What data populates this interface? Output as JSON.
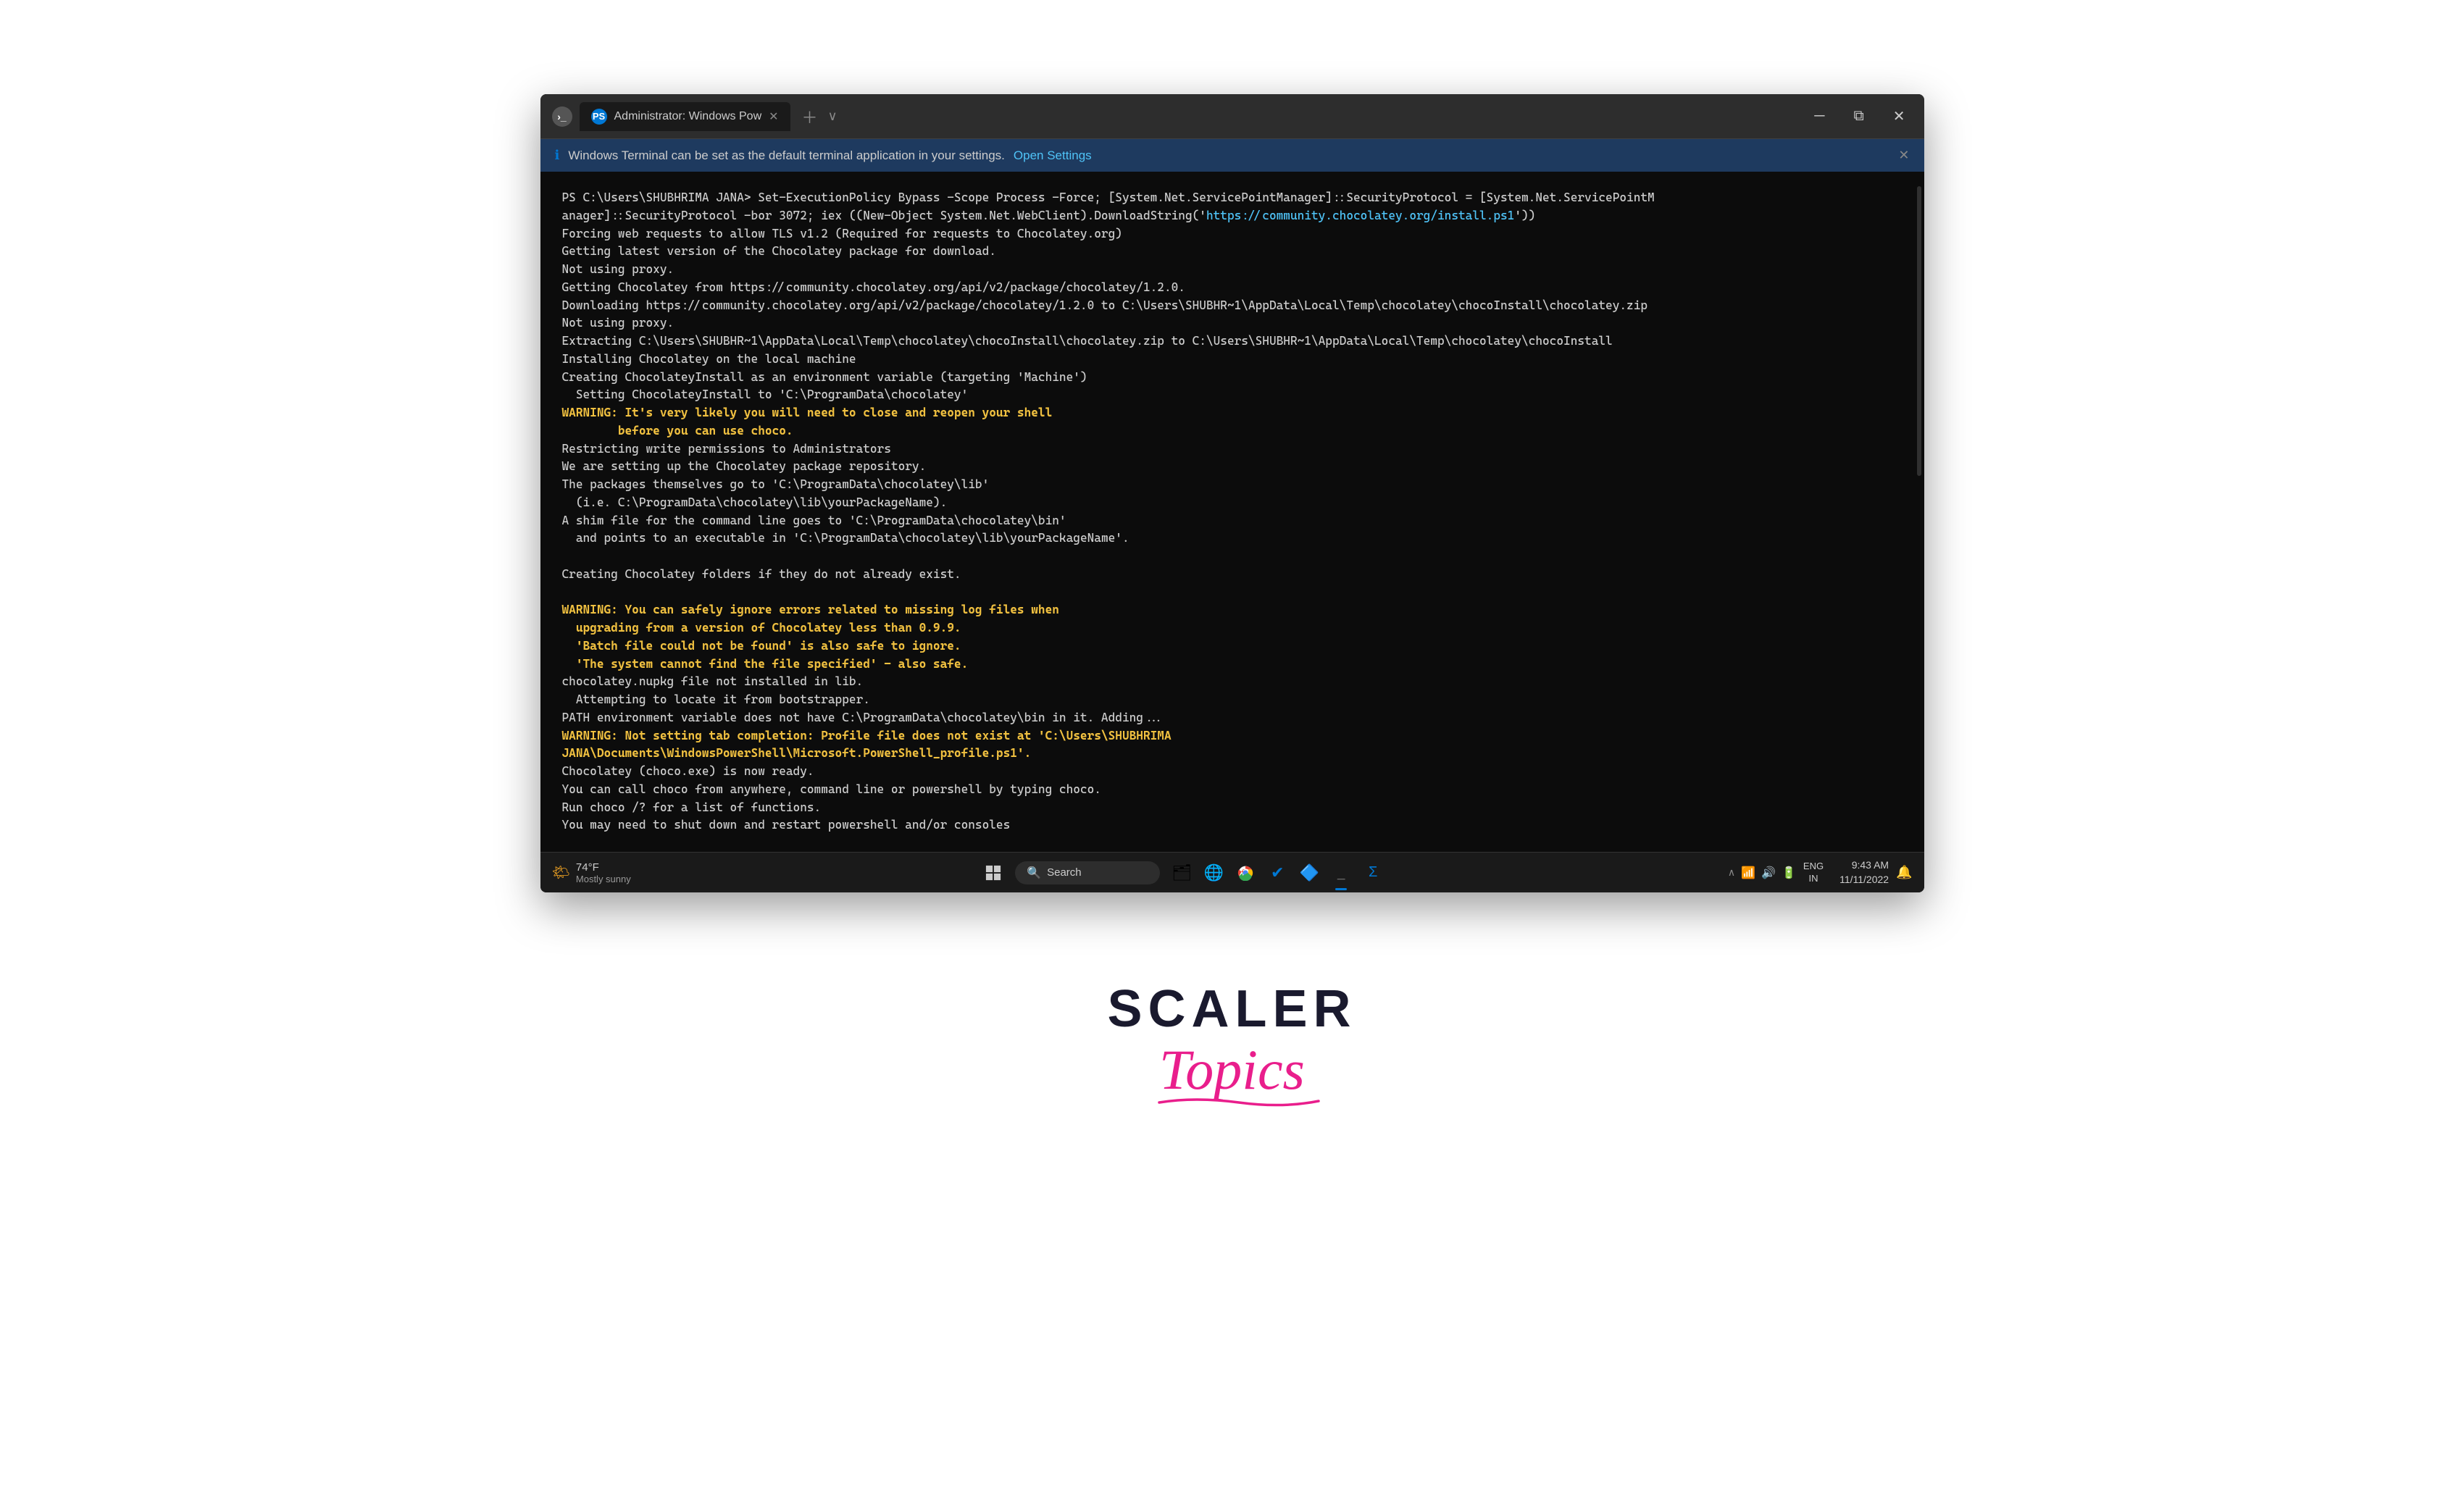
{
  "terminal": {
    "title_tab": "Administrator: Windows Pow",
    "tab_icon": "PS",
    "notification_text": "Windows Terminal can be set as the default terminal application in your settings.",
    "open_settings_label": "Open Settings",
    "terminal_lines": [
      {
        "id": 1,
        "text": "PS C:\\Users\\SHUBHRIMA JANA> Set-ExecutionPolicy Bypass -Scope Process -Force; [System.Net.ServicePointManager]::SecurityProtocol = [System.Net.ServicePointM",
        "style": "normal"
      },
      {
        "id": 2,
        "text": "anager]::SecurityProtocol -bor 3072; iex ((New-Object System.Net.WebClient).DownloadString('https://community.chocolatey.org/install.ps1'))",
        "style": "link-part"
      },
      {
        "id": 3,
        "text": "Forcing web requests to allow TLS v1.2 (Required for requests to Chocolatey.org)",
        "style": "normal"
      },
      {
        "id": 4,
        "text": "Getting latest version of the Chocolatey package for download.",
        "style": "normal"
      },
      {
        "id": 5,
        "text": "Not using proxy.",
        "style": "normal"
      },
      {
        "id": 6,
        "text": "Getting Chocolatey from https://community.chocolatey.org/api/v2/package/chocolatey/1.2.0.",
        "style": "normal"
      },
      {
        "id": 7,
        "text": "Downloading https://community.chocolatey.org/api/v2/package/chocolatey/1.2.0 to C:\\Users\\SHUBHR~1\\AppData\\Local\\Temp\\chocolatey\\chocoInstall\\chocolatey.zip",
        "style": "normal"
      },
      {
        "id": 8,
        "text": "Not using proxy.",
        "style": "normal"
      },
      {
        "id": 9,
        "text": "Extracting C:\\Users\\SHUBHR~1\\AppData\\Local\\Temp\\chocolatey\\chocoInstall\\chocolatey.zip to C:\\Users\\SHUBHR~1\\AppData\\Local\\Temp\\chocolatey\\chocoInstall",
        "style": "normal"
      },
      {
        "id": 10,
        "text": "Installing Chocolatey on the local machine",
        "style": "normal"
      },
      {
        "id": 11,
        "text": "Creating ChocolateyInstall as an environment variable (targeting 'Machine')",
        "style": "normal"
      },
      {
        "id": 12,
        "text": "  Setting ChocolateyInstall to 'C:\\ProgramData\\chocolatey'",
        "style": "normal"
      },
      {
        "id": 13,
        "text": "WARNING: It's very likely you will need to close and reopen your shell",
        "style": "warning"
      },
      {
        "id": 14,
        "text": "        before you can use choco.",
        "style": "warning"
      },
      {
        "id": 15,
        "text": "Restricting write permissions to Administrators",
        "style": "normal"
      },
      {
        "id": 16,
        "text": "We are setting up the Chocolatey package repository.",
        "style": "normal"
      },
      {
        "id": 17,
        "text": "The packages themselves go to 'C:\\ProgramData\\chocolatey\\lib'",
        "style": "normal"
      },
      {
        "id": 18,
        "text": "  (i.e. C:\\ProgramData\\chocolatey\\lib\\yourPackageName).",
        "style": "normal"
      },
      {
        "id": 19,
        "text": "A shim file for the command line goes to 'C:\\ProgramData\\chocolatey\\bin'",
        "style": "normal"
      },
      {
        "id": 20,
        "text": "  and points to an executable in 'C:\\ProgramData\\chocolatey\\lib\\yourPackageName'.",
        "style": "normal"
      },
      {
        "id": 21,
        "text": "",
        "style": "normal"
      },
      {
        "id": 22,
        "text": "Creating Chocolatey folders if they do not already exist.",
        "style": "normal"
      },
      {
        "id": 23,
        "text": "",
        "style": "normal"
      },
      {
        "id": 24,
        "text": "WARNING: You can safely ignore errors related to missing log files when",
        "style": "warning"
      },
      {
        "id": 25,
        "text": "  upgrading from a version of Chocolatey less than 0.9.9.",
        "style": "warning"
      },
      {
        "id": 26,
        "text": "  'Batch file could not be found' is also safe to ignore.",
        "style": "warning"
      },
      {
        "id": 27,
        "text": "  'The system cannot find the file specified' - also safe.",
        "style": "warning"
      },
      {
        "id": 28,
        "text": "chocolatey.nupkg file not installed in lib.",
        "style": "normal"
      },
      {
        "id": 29,
        "text": "  Attempting to locate it from bootstrapper.",
        "style": "normal"
      },
      {
        "id": 30,
        "text": "PATH environment variable does not have C:\\ProgramData\\chocolatey\\bin in it. Adding...",
        "style": "normal"
      },
      {
        "id": 31,
        "text": "WARNING: Not setting tab completion: Profile file does not exist at 'C:\\Users\\SHUBHRIMA",
        "style": "warning"
      },
      {
        "id": 32,
        "text": "JANA\\Documents\\WindowsPowerShell\\Microsoft.PowerShell_profile.ps1'.",
        "style": "warning"
      },
      {
        "id": 33,
        "text": "Chocolatey (choco.exe) is now ready.",
        "style": "normal"
      },
      {
        "id": 34,
        "text": "You can call choco from anywhere, command line or powershell by typing choco.",
        "style": "normal"
      },
      {
        "id": 35,
        "text": "Run choco /? for a list of functions.",
        "style": "normal"
      },
      {
        "id": 36,
        "text": "You may need to shut down and restart powershell and/or consoles",
        "style": "normal"
      }
    ]
  },
  "taskbar": {
    "weather_temp": "74°F",
    "weather_desc": "Mostly sunny",
    "search_label": "Search",
    "time": "9:43 AM",
    "date": "11/11/2022",
    "language": "ENG\nIN"
  },
  "branding": {
    "scaler_text": "SCALER",
    "topics_text": "Topics"
  },
  "colors": {
    "terminal_bg": "#0c0c0c",
    "titlebar_bg": "#2d2d2d",
    "tab_active_bg": "#1a1a1a",
    "brand_dark": "#1a1a2e",
    "brand_pink": "#e91e8c",
    "link_color": "#4fc3f7",
    "warning_color": "#f0c040",
    "notification_bg": "#1e3a5f"
  }
}
